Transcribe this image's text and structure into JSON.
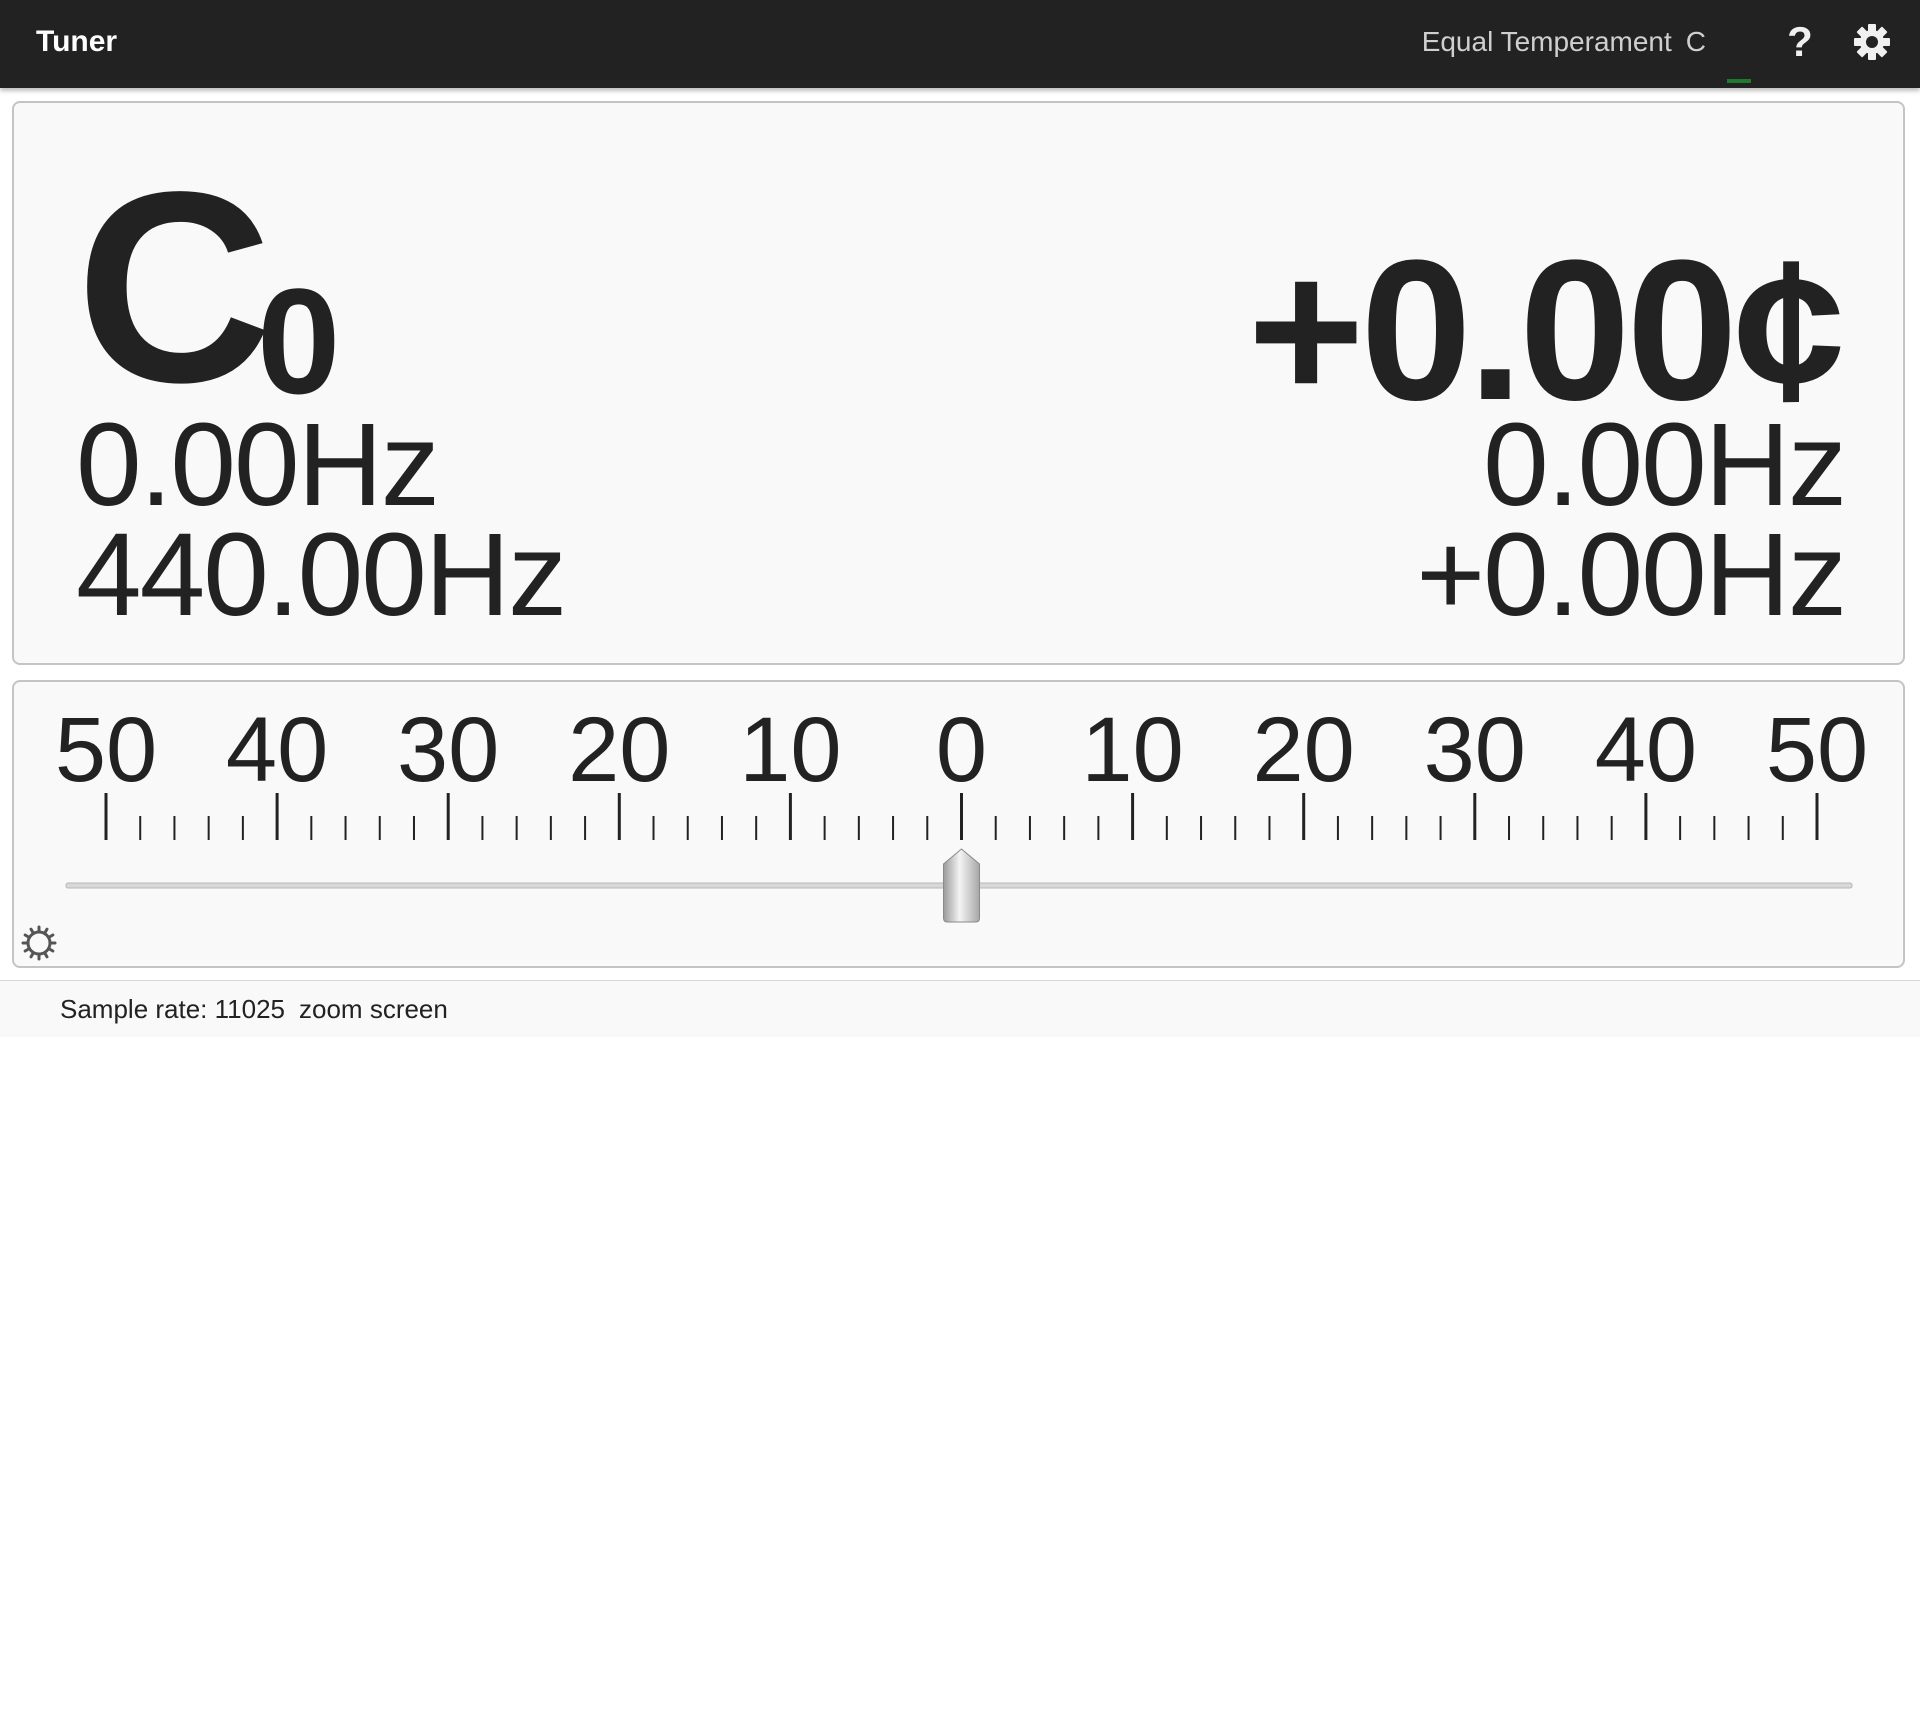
{
  "app": {
    "title": "Tuner"
  },
  "toolbar": {
    "temperament": "Equal Temperament",
    "key": "C",
    "help_label": "?",
    "icons": [
      "help-icon",
      "gear-icon"
    ]
  },
  "readout": {
    "note": "C",
    "octave": "0",
    "cents": "+0.00¢",
    "detected_frequency": "0.00Hz",
    "reference_frequency": "440.00Hz",
    "target_frequency": "0.00Hz",
    "frequency_difference": "+0.00Hz"
  },
  "scale": {
    "labels": [
      "50",
      "40",
      "30",
      "20",
      "10",
      "0",
      "10",
      "20",
      "30",
      "40",
      "50"
    ],
    "range_cents": [
      -50,
      50
    ],
    "needle_cents": 0,
    "icon": "gear-icon"
  },
  "status": {
    "sample_rate_label": "Sample rate:",
    "sample_rate": "11025",
    "zoom_label": "zoom screen"
  },
  "colors": {
    "appbar": "#222222",
    "panel": "#f9f9f9",
    "text": "#222222",
    "indicator": "#1f7a2e"
  }
}
